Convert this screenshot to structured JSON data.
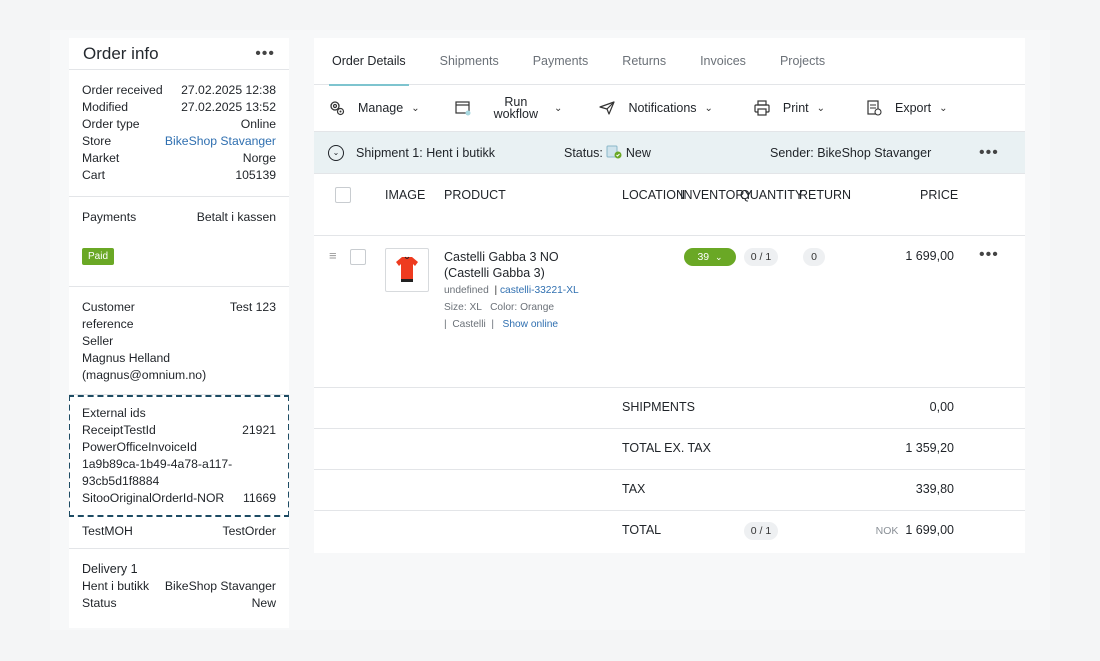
{
  "order_info": {
    "title": "Order info",
    "menu": "•••",
    "rows": [
      {
        "label": "Order received",
        "value": "27.02.2025 12:38"
      },
      {
        "label": "Modified",
        "value": "27.02.2025 13:52"
      },
      {
        "label": "Order type",
        "value": "Online"
      },
      {
        "label": "Store",
        "value": "BikeShop Stavanger"
      },
      {
        "label": "Market",
        "value": "Norge"
      },
      {
        "label": "Cart",
        "value": "105139"
      }
    ],
    "payments": {
      "label": "Payments",
      "value": "Betalt i kassen",
      "badge": "Paid"
    },
    "customer": {
      "label": "Customer",
      "value": "Test 123",
      "reference": "reference",
      "seller": "Seller",
      "seller_name": "Magnus Helland",
      "seller_email": "(magnus@omnium.no)"
    },
    "external": {
      "title": "External ids",
      "receipt_label": "ReceiptTestId",
      "receipt_value": "21921",
      "poweroffice_label": "PowerOfficeInvoiceId",
      "poweroffice_value_1": "1a9b89ca-1b49-4a78-a117-",
      "poweroffice_value_2": "93cb5d1f8884",
      "sitoo_label": "SitooOriginalOrderId-NOR",
      "sitoo_value": "11669"
    },
    "testmoh": {
      "label": "TestMOH",
      "value": "TestOrder"
    },
    "delivery": {
      "title": "Delivery 1",
      "label": "Hent i butikk",
      "value": "BikeShop Stavanger",
      "status_label": "Status",
      "status_value": "New"
    }
  },
  "tabs": [
    "Order Details",
    "Shipments",
    "Payments",
    "Returns",
    "Invoices",
    "Projects"
  ],
  "toolbar": {
    "manage": "Manage",
    "run_1": "Run",
    "run_2": "wokflow",
    "notifications": "Notifications",
    "print": "Print",
    "export": "Export"
  },
  "shipment": {
    "title": "Shipment 1:",
    "method": "Hent i butikk",
    "status_label": "Status:",
    "status_value": "New",
    "sender_label": "Sender:",
    "sender_value": "BikeShop Stavanger",
    "menu": "•••"
  },
  "table": {
    "headers": {
      "image": "IMAGE",
      "product": "PRODUCT",
      "location": "LOCATION",
      "inventory": "INVENTORY",
      "quantity": "QUANTITY",
      "return": "RETURN",
      "price": "PRICE"
    },
    "item": {
      "name_1": "Castelli Gabba 3 NO",
      "name_2": "(Castelli Gabba 3)",
      "undefined": "undefined",
      "sku": "castelli-33221-XL",
      "size": "Size: XL",
      "color": "Color: Orange",
      "brand": "Castelli",
      "show_online": "Show online",
      "inventory": "39",
      "quantity": "0 / 1",
      "return": "0",
      "price": "1 699,00",
      "menu": "•••"
    }
  },
  "summary": {
    "shipments_label": "SHIPMENTS",
    "shipments_value": "0,00",
    "total_ex_tax_label": "TOTAL EX. TAX",
    "total_ex_tax_value": "1 359,20",
    "tax_label": "TAX",
    "tax_value": "339,80",
    "total_label": "TOTAL",
    "total_qty": "0 / 1",
    "currency": "NOK",
    "total_value": "1 699,00"
  },
  "colors": {
    "accent": "#7ec4cf",
    "paid": "#6aa825",
    "link": "#2f6fb0",
    "ship_bar": "#e9f1f3"
  }
}
